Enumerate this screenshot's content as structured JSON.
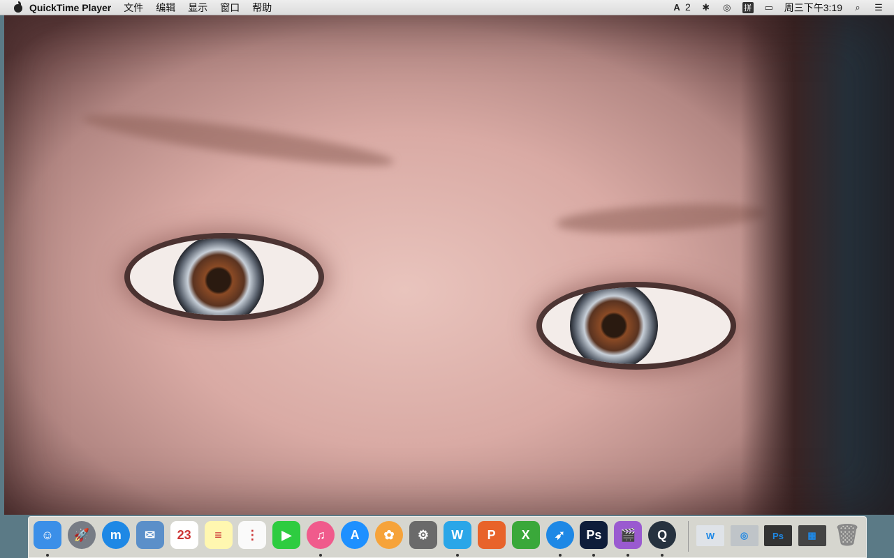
{
  "menubar": {
    "app_name": "QuickTime Player",
    "menus": [
      "文件",
      "编辑",
      "显示",
      "窗口",
      "帮助"
    ],
    "status": {
      "adobe_count": "2",
      "input_method": "拼",
      "clock": "周三下午3:19"
    }
  },
  "dock": {
    "apps": [
      {
        "name": "Finder",
        "color": "#3b8fe8",
        "glyph": "☺",
        "running": true
      },
      {
        "name": "Launchpad",
        "color": "#777c85",
        "glyph": "🚀",
        "running": false
      },
      {
        "name": "Maxthon",
        "color": "#1e88e5",
        "glyph": "m",
        "running": false
      },
      {
        "name": "Mail",
        "color": "#5b8fc9",
        "glyph": "✉",
        "running": false
      },
      {
        "name": "Calendar",
        "color": "#ffffff",
        "glyph": "23",
        "running": false
      },
      {
        "name": "Notes",
        "color": "#fff7b0",
        "glyph": "≡",
        "running": false
      },
      {
        "name": "Reminders",
        "color": "#fafafa",
        "glyph": "⋮",
        "running": false
      },
      {
        "name": "FaceTime",
        "color": "#2ecc40",
        "glyph": "▶",
        "running": false
      },
      {
        "name": "iTunes",
        "color": "#f05b8c",
        "glyph": "♫",
        "running": true
      },
      {
        "name": "App Store",
        "color": "#1e90ff",
        "glyph": "A",
        "running": false
      },
      {
        "name": "Photos",
        "color": "#f6a33a",
        "glyph": "✿",
        "running": false
      },
      {
        "name": "System Preferences",
        "color": "#6a6a6a",
        "glyph": "⚙",
        "running": false
      },
      {
        "name": "Microsoft Word",
        "color": "#2aa6e8",
        "glyph": "W",
        "running": true
      },
      {
        "name": "Microsoft PowerPoint",
        "color": "#e8632a",
        "glyph": "P",
        "running": false
      },
      {
        "name": "Microsoft Excel",
        "color": "#3aa83a",
        "glyph": "X",
        "running": false
      },
      {
        "name": "Safari",
        "color": "#1e88e5",
        "glyph": "➶",
        "running": true
      },
      {
        "name": "Photoshop",
        "color": "#0e1d3a",
        "glyph": "Ps",
        "running": true
      },
      {
        "name": "Final Cut Pro",
        "color": "#9a5ad0",
        "glyph": "🎬",
        "running": true
      },
      {
        "name": "QuickTime Player",
        "color": "#26323f",
        "glyph": "Q",
        "running": true
      }
    ],
    "minimized": [
      {
        "name": "Word window",
        "color": "#dfe3e8",
        "glyph": "W"
      },
      {
        "name": "Safari window",
        "color": "#bfc4c8",
        "glyph": "◎"
      },
      {
        "name": "Photoshop window",
        "color": "#333",
        "glyph": "Ps"
      },
      {
        "name": "Final Cut window",
        "color": "#444",
        "glyph": "▦"
      }
    ],
    "trash": {
      "name": "Trash",
      "glyph": "🗑"
    }
  }
}
